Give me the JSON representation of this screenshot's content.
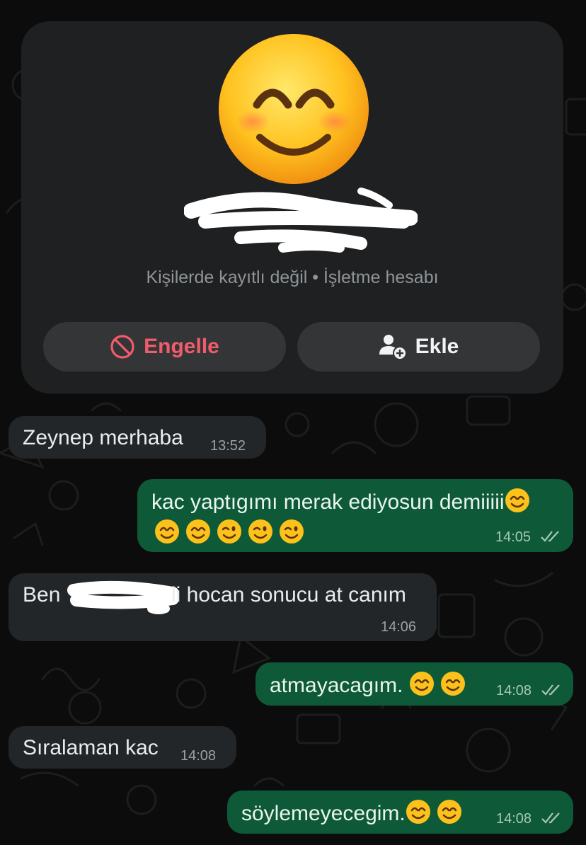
{
  "contact_card": {
    "avatar_icon": "smiling-face-emoji",
    "subtitle": "Kişilerde kayıtlı değil • İşletme hesabı",
    "block_button": {
      "label": "Engelle",
      "icon": "block-icon",
      "color": "#f15c6d"
    },
    "add_button": {
      "label": "Ekle",
      "icon": "add-contact-icon"
    }
  },
  "messages": [
    {
      "direction": "in",
      "text": "Zeynep merhaba",
      "time": "13:52"
    },
    {
      "direction": "out",
      "text_line1": "kac yaptıgımı merak ediyosun demiiiii",
      "time": "14:05",
      "read": true,
      "emojis_line1": [
        "smiling-face-emoji"
      ],
      "emojis_line2": [
        "smiling-face-emoji",
        "smiling-face-emoji",
        "winking-face-emoji",
        "winking-face-emoji",
        "winking-face-emoji"
      ]
    },
    {
      "direction": "in",
      "text_before": "Ben ",
      "text_after": "li hocan sonucu at canım",
      "time": "14:06"
    },
    {
      "direction": "out",
      "text": "atmayacagım. ",
      "time": "14:08",
      "read": true,
      "emojis": [
        "smiling-face-emoji",
        "smiling-face-emoji"
      ]
    },
    {
      "direction": "in",
      "text": "Sıralaman kac",
      "time": "14:08"
    },
    {
      "direction": "out",
      "text": "söylemeyecegim.",
      "time": "14:08",
      "read": true,
      "emojis": [
        "smiling-face-emoji",
        "smiling-face-emoji"
      ]
    }
  ],
  "colors": {
    "background": "#0c0c0c",
    "incoming_bubble": "#232628",
    "outgoing_bubble": "#0e5a38",
    "card": "#1f2021",
    "danger": "#f15c6d"
  }
}
